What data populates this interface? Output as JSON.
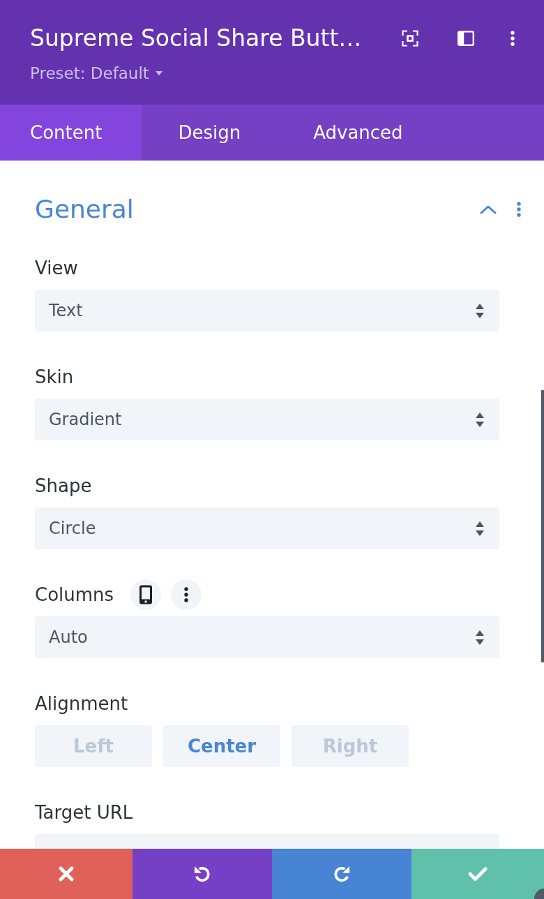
{
  "header": {
    "title": "Supreme Social Share Butt…",
    "preset": "Preset: Default"
  },
  "tabs": [
    {
      "label": "Content",
      "selected": true
    },
    {
      "label": "Design",
      "selected": false
    },
    {
      "label": "Advanced",
      "selected": false
    }
  ],
  "section": {
    "title": "General",
    "expanded": true,
    "fields": [
      {
        "kind": "select",
        "label": "View",
        "value": "Text"
      },
      {
        "kind": "select",
        "label": "Skin",
        "value": "Gradient"
      },
      {
        "kind": "select",
        "label": "Shape",
        "value": "Circle"
      },
      {
        "kind": "select",
        "label": "Columns",
        "value": "Auto",
        "responsive": true
      },
      {
        "kind": "segmented",
        "label": "Alignment",
        "options": [
          {
            "label": "Left",
            "selected": false
          },
          {
            "label": "Center",
            "selected": true
          },
          {
            "label": "Right",
            "selected": false
          }
        ]
      },
      {
        "kind": "select",
        "label": "Target URL"
      }
    ]
  },
  "footer": {
    "buttons": [
      {
        "kind": "cancel"
      },
      {
        "kind": "undo"
      },
      {
        "kind": "redo"
      },
      {
        "kind": "save"
      }
    ]
  }
}
